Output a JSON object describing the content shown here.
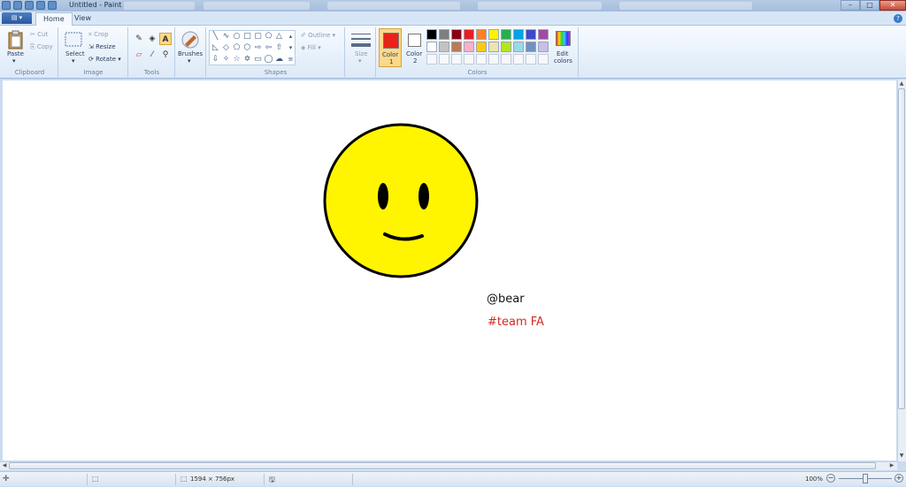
{
  "window": {
    "title": "Untitled - Paint"
  },
  "tabs": {
    "home": "Home",
    "view": "View"
  },
  "clipboard": {
    "paste": "Paste",
    "cut": "Cut",
    "copy": "Copy",
    "group": "Clipboard"
  },
  "image": {
    "select": "Select",
    "crop": "Crop",
    "resize": "Resize",
    "rotate": "Rotate",
    "group": "Image"
  },
  "tools": {
    "group": "Tools",
    "brushes": "Brushes"
  },
  "shapes": {
    "outline": "Outline",
    "fill": "Fill",
    "group": "Shapes",
    "size": "Size"
  },
  "colors": {
    "color1": "Color",
    "color1_num": "1",
    "color2": "Color",
    "color2_num": "2",
    "edit": "Edit",
    "edit2": "colors",
    "group": "Colors",
    "color1_value": "#e8231b",
    "color2_value": "#ffffff",
    "palette_row1": [
      "#000000",
      "#7f7f7f",
      "#880015",
      "#ed1c24",
      "#ff7f27",
      "#fff200",
      "#22b14c",
      "#00a2e8",
      "#3f48cc",
      "#a349a4"
    ],
    "palette_row2": [
      "#ffffff",
      "#c3c3c3",
      "#b97a57",
      "#ffaec9",
      "#ffc90e",
      "#efe4b0",
      "#b5e61d",
      "#99d9ea",
      "#7092be",
      "#c8bfe7"
    ]
  },
  "drawing": {
    "handle": "@bear",
    "tag": "#team FA",
    "face_fill": "#fff500",
    "tag_color": "#d22a22"
  },
  "status": {
    "dimensions": "1594 × 756px",
    "zoom": "100%"
  }
}
